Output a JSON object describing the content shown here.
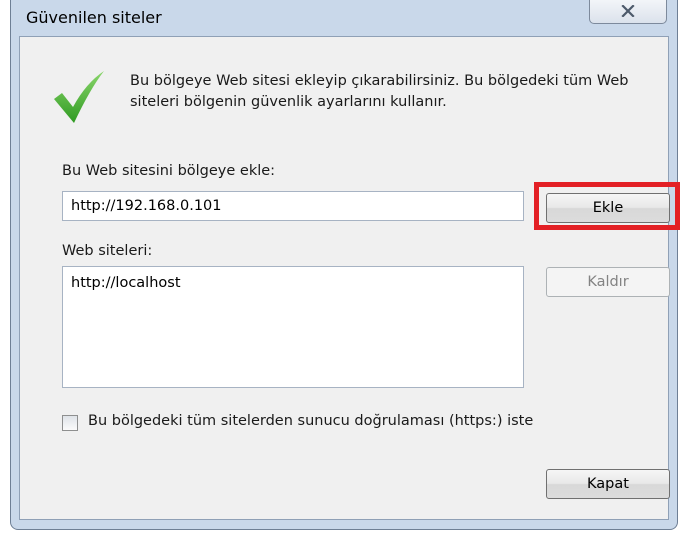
{
  "window": {
    "title": "Güvenilen siteler"
  },
  "info": {
    "text": "Bu bölgeye Web sitesi ekleyip çıkarabilirsiniz. Bu bölgedeki tüm Web siteleri bölgenin güvenlik ayarlarını kullanır."
  },
  "add_site": {
    "label": "Bu Web sitesini bölgeye ekle:",
    "value": "http://192.168.0.101",
    "button_label": "Ekle"
  },
  "sites": {
    "label": "Web siteleri:",
    "items": [
      "http://localhost"
    ],
    "remove_label": "Kaldır"
  },
  "https_option": {
    "label": "Bu bölgedeki tüm sitelerden sunucu doğrulaması (https:) iste",
    "checked": false
  },
  "footer": {
    "close_label": "Kapat"
  },
  "colors": {
    "highlight": "#e32025",
    "check_icon": "#3fae2a"
  }
}
